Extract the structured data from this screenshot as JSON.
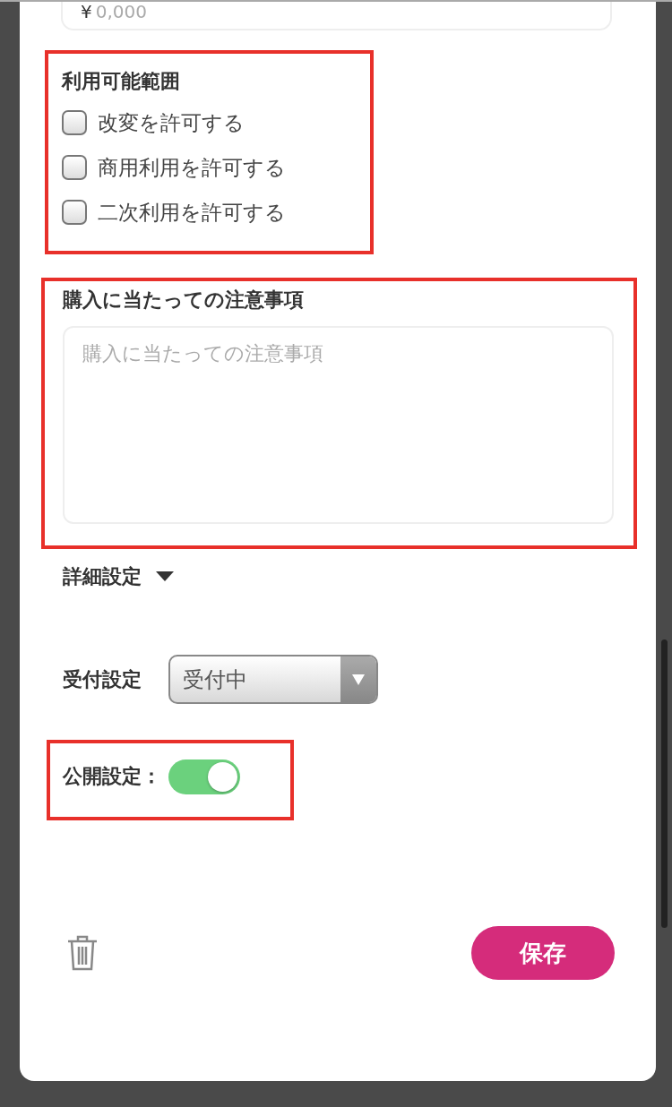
{
  "price_field": {
    "prefix": "¥",
    "placeholder": "0,000"
  },
  "usage_scope": {
    "title": "利用可能範囲",
    "options": [
      {
        "label": "改変を許可する",
        "checked": false
      },
      {
        "label": "商用利用を許可する",
        "checked": false
      },
      {
        "label": "二次利用を許可する",
        "checked": false
      }
    ]
  },
  "notes": {
    "title": "購入に当たっての注意事項",
    "placeholder": "購入に当たっての注意事項"
  },
  "advanced": {
    "label": "詳細設定",
    "expanded": false
  },
  "reception": {
    "label": "受付設定",
    "value": "受付中"
  },
  "publish": {
    "label": "公開設定：",
    "on": true
  },
  "save_button": "保存"
}
